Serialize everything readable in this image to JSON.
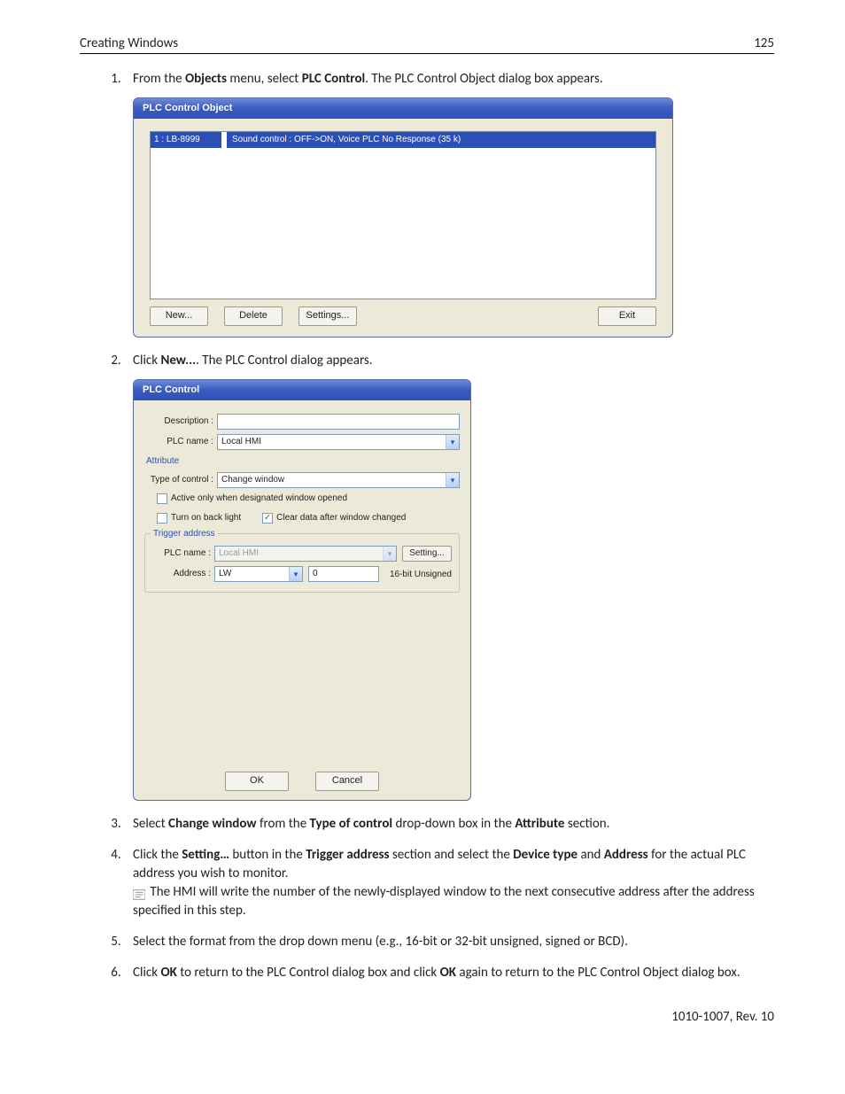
{
  "header": {
    "left": "Creating Windows",
    "right": "125"
  },
  "steps": {
    "s1": {
      "pre": "From the ",
      "menu_bold": "Objects",
      "mid": " menu, select ",
      "item_bold": "PLC Control",
      "post": ". The PLC Control Object dialog box appears."
    },
    "s2": {
      "pre": "Click ",
      "btn_bold": "New...",
      "post": ". The PLC Control dialog appears."
    },
    "s3": {
      "pre": "Select ",
      "b1": "Change window",
      "mid1": " from the ",
      "b2": "Type of control",
      "mid2": " drop-down box in the ",
      "b3": "Attribute",
      "post": " section."
    },
    "s4": {
      "pre": "Click the ",
      "b1": "Setting…",
      "mid1": " button in the ",
      "b2": "Trigger address",
      "mid2": " section and select the ",
      "b3": "Device type",
      "mid3": " and ",
      "b4": "Address",
      "post": " for the actual PLC address you wish to monitor.",
      "note": " The HMI will write the number of the newly-displayed window to the next consecutive address after the address specified in this step."
    },
    "s5": "Select the format from the drop down menu (e.g., 16-bit or 32-bit unsigned, signed or BCD).",
    "s6": {
      "pre": "Click ",
      "b1": "OK",
      "mid1": " to return to the PLC Control dialog box and click ",
      "b2": "OK",
      "post": " again to return to the PLC Control Object dialog box."
    }
  },
  "dlg1": {
    "title": "PLC Control Object",
    "row": {
      "cell1": "1 :   LB-8999",
      "cell2": "Sound control : OFF->ON, Voice PLC No Response (35 k)"
    },
    "buttons": {
      "new": "New...",
      "delete": "Delete",
      "settings": "Settings...",
      "exit": "Exit"
    }
  },
  "dlg2": {
    "title": "PLC Control",
    "labels": {
      "description": "Description :",
      "plcname": "PLC name :",
      "attribute": "Attribute",
      "typeofcontrol": "Type of control :",
      "active": "Active only when designated window opened",
      "backlight": "Turn on back light",
      "cleardata": "Clear data after window changed",
      "trigger": "Trigger address",
      "plcname2": "PLC name :",
      "setting": "Setting...",
      "address": "Address :",
      "format": "16-bit Unsigned",
      "ok": "OK",
      "cancel": "Cancel"
    },
    "values": {
      "description": "",
      "plcname": "Local HMI",
      "typeofcontrol": "Change window",
      "plcname2": "Local HMI",
      "addr_type": "LW",
      "addr_val": "0",
      "cleardata_checked": "✓"
    }
  },
  "footer": "1010-1007, Rev. 10"
}
